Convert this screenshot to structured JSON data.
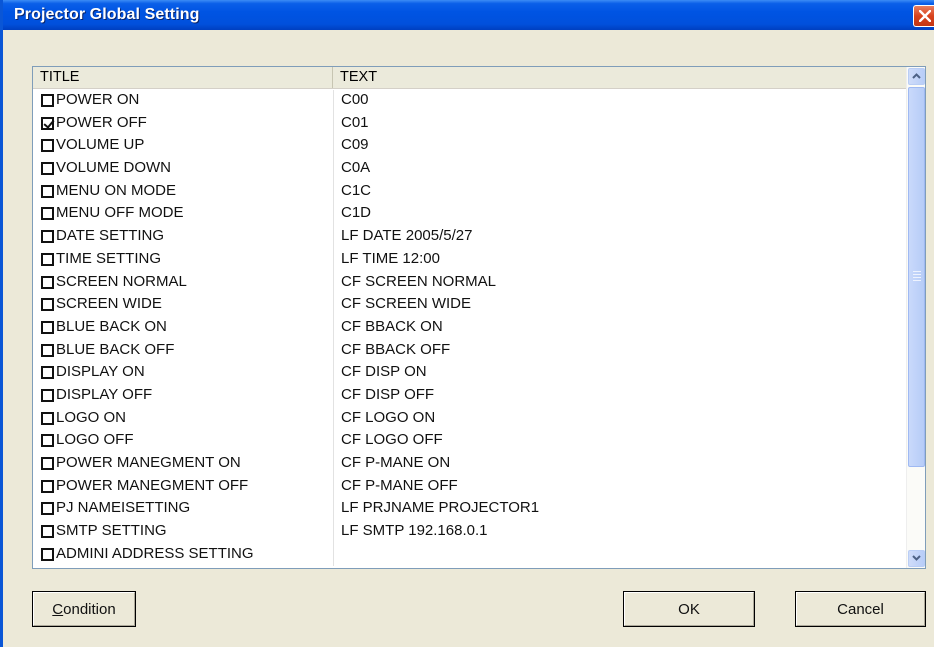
{
  "window": {
    "title": "Projector Global Setting"
  },
  "list": {
    "columns": [
      "TITLE",
      "TEXT"
    ],
    "rows": [
      {
        "title": "POWER ON",
        "text": "C00",
        "checked": false
      },
      {
        "title": "POWER OFF",
        "text": "C01",
        "checked": true
      },
      {
        "title": "VOLUME UP",
        "text": "C09",
        "checked": false
      },
      {
        "title": "VOLUME DOWN",
        "text": "C0A",
        "checked": false
      },
      {
        "title": "MENU ON  MODE",
        "text": "C1C",
        "checked": false
      },
      {
        "title": "MENU OFF MODE",
        "text": "C1D",
        "checked": false
      },
      {
        "title": "DATE SETTING",
        "text": "LF DATE 2005/5/27",
        "checked": false
      },
      {
        "title": "TIME SETTING",
        "text": "LF TIME 12:00",
        "checked": false
      },
      {
        "title": "SCREEN NORMAL",
        "text": "CF SCREEN NORMAL",
        "checked": false
      },
      {
        "title": "SCREEN WIDE",
        "text": "CF SCREEN WIDE",
        "checked": false
      },
      {
        "title": "BLUE BACK ON",
        "text": "CF BBACK ON",
        "checked": false
      },
      {
        "title": "BLUE BACK OFF",
        "text": "CF BBACK OFF",
        "checked": false
      },
      {
        "title": "DISPLAY ON",
        "text": "CF DISP ON",
        "checked": false
      },
      {
        "title": "DISPLAY OFF",
        "text": "CF DISP OFF",
        "checked": false
      },
      {
        "title": "LOGO ON",
        "text": "CF LOGO ON",
        "checked": false
      },
      {
        "title": "LOGO OFF",
        "text": "CF LOGO OFF",
        "checked": false
      },
      {
        "title": "POWER MANEGMENT ON",
        "text": "CF P-MANE ON",
        "checked": false
      },
      {
        "title": "POWER MANEGMENT OFF",
        "text": "CF P-MANE OFF",
        "checked": false
      },
      {
        "title": "PJ NAMEISETTING",
        "text": "LF PRJNAME PROJECTOR1",
        "checked": false
      },
      {
        "title": "SMTP SETTING",
        "text": "LF SMTP 192.168.0.1",
        "checked": false
      },
      {
        "title": "ADMINI ADDRESS SETTING",
        "text": "",
        "checked": false
      }
    ]
  },
  "buttons": {
    "condition_mnemonic": "C",
    "condition_rest": "ondition",
    "ok": "OK",
    "cancel": "Cancel"
  },
  "icons": {
    "close": "close-x-icon",
    "scroll_up": "chevron-up-icon",
    "scroll_down": "chevron-down-icon"
  },
  "colors": {
    "titlebar": "#0054e3",
    "close": "#d8421d",
    "face": "#ece9d8",
    "scroll": "#c1d3fb"
  }
}
